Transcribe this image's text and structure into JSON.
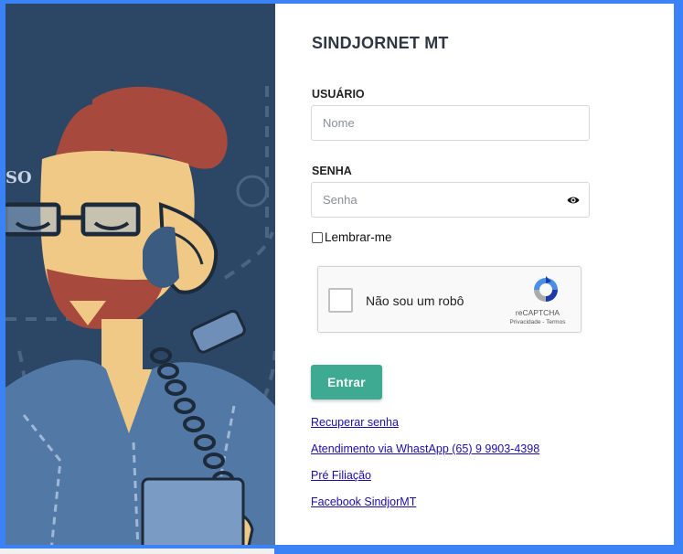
{
  "brand": "SINDJORNET MT",
  "login": {
    "user_label": "USUÁRIO",
    "user_placeholder": "Nome",
    "pass_label": "SENHA",
    "pass_placeholder": "Senha",
    "remember_label": "Lembrar-me",
    "submit_label": "Entrar"
  },
  "captcha": {
    "text": "Não sou um robô",
    "brand": "reCAPTCHA",
    "terms": "Privacidade - Termos"
  },
  "illustration": {
    "partial_text": "SO"
  },
  "links": [
    "Recuperar senha",
    "Atendimento via WhastApp (65) 9 9903-4398",
    "Pré Filiação",
    "Facebook SindjorMT"
  ],
  "colors": {
    "frame": "#3b82f6",
    "illustration_bg": "#2c4666",
    "accent_button": "#3faa92",
    "link": "#1a0dab"
  }
}
